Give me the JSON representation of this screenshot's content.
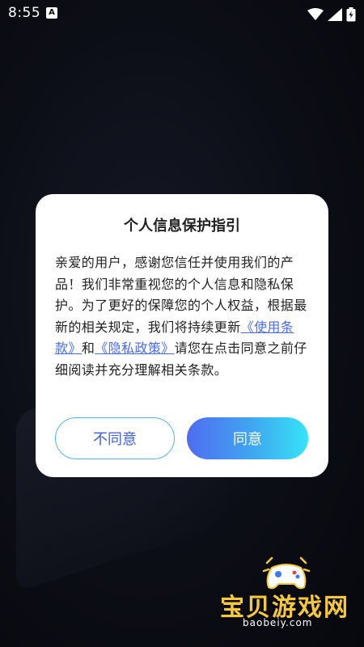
{
  "status_bar": {
    "time": "8:55",
    "notification_icon": "A"
  },
  "dialog": {
    "title": "个人信息保护指引",
    "body_before": "亲爱的用户，感谢您信任并使用我们的产品！我们非常重视您的个人信息和隐私保护。为了更好的保障您的个人权益，根据最新的相关规定，我们将持续更新",
    "terms_link": "《使用条款》",
    "and_text": "和",
    "privacy_link": "《隐私政策》",
    "body_after": "请您在点击同意之前仔细阅读并充分理解相关条款。",
    "disagree_label": "不同意",
    "agree_label": "同意"
  },
  "watermark": {
    "text": "宝贝游戏网",
    "url": "baobeiy.com"
  },
  "colors": {
    "link": "#4a6cf0",
    "agree_gradient_start": "#4f6cf2",
    "agree_gradient_end": "#37e3f8",
    "watermark": "#f6c93a"
  }
}
